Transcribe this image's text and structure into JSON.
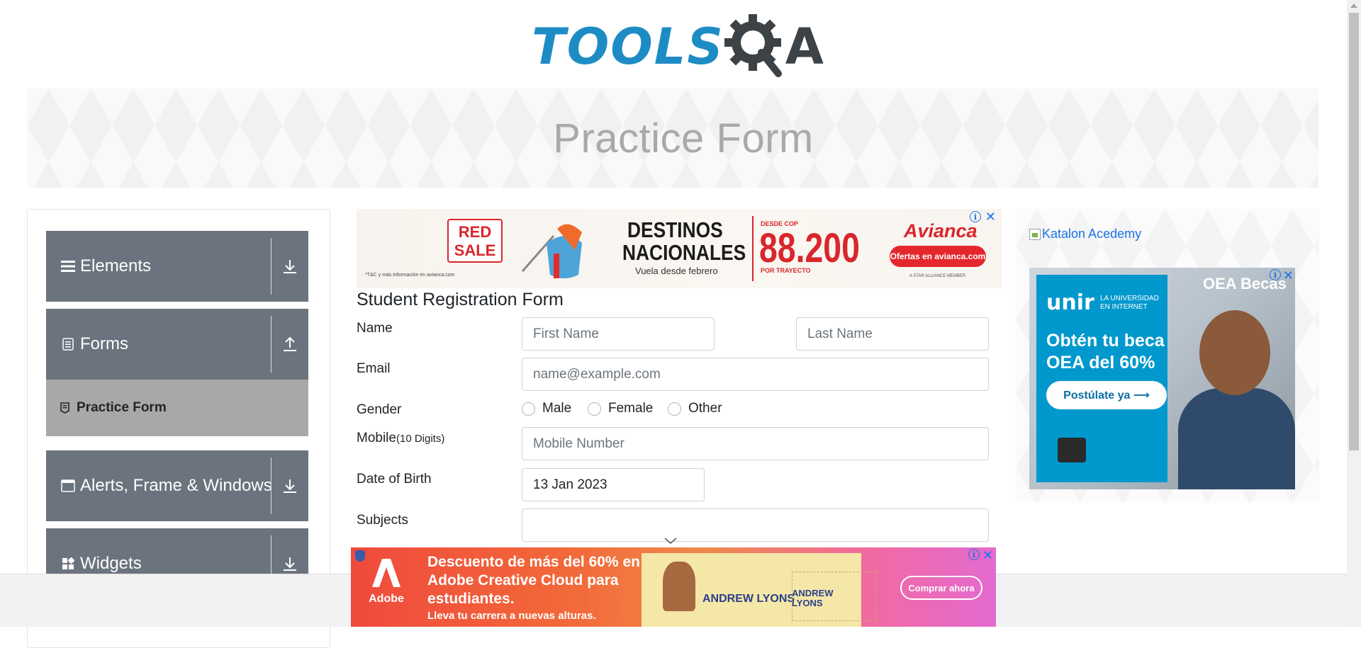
{
  "header": {
    "logo_text": "TOOLSQA",
    "logo_tools": "TOOLS",
    "logo_a": "A"
  },
  "banner": {
    "title": "Practice Form"
  },
  "sidebar": {
    "groups": [
      {
        "label": "Elements",
        "icon": "menu-icon",
        "expanded": false
      },
      {
        "label": "Forms",
        "icon": "document-icon",
        "expanded": true
      },
      {
        "label": "Alerts, Frame & Windows",
        "icon": "window-icon",
        "expanded": false
      },
      {
        "label": "Widgets",
        "icon": "widgets-icon",
        "expanded": false
      }
    ],
    "active_item": {
      "label": "Practice Form",
      "icon": "file-icon"
    }
  },
  "ad_top": {
    "badge": "RED SALE",
    "headline": "DESTINOS NACIONALES",
    "subline": "Vuela desde febrero",
    "price_prefix": "DESDE COP",
    "price": "88.200",
    "price_suffix": "POR TRAYECTO",
    "brand": "Avianca",
    "cta": "Ofertas en avianca.com",
    "fineprint": "*T&C y más información en avianca.com",
    "alliance": "A STAR ALLIANCE MEMBER"
  },
  "form": {
    "title": "Student Registration Form",
    "name_label": "Name",
    "first_name_placeholder": "First Name",
    "last_name_placeholder": "Last Name",
    "email_label": "Email",
    "email_placeholder": "name@example.com",
    "gender_label": "Gender",
    "gender_options": [
      "Male",
      "Female",
      "Other"
    ],
    "mobile_label": "Mobile",
    "mobile_hint": "(10 Digits)",
    "mobile_placeholder": "Mobile Number",
    "dob_label": "Date of Birth",
    "dob_value": "13 Jan 2023",
    "subjects_label": "Subjects"
  },
  "right_ad": {
    "katalon_alt": "Katalon Acedemy",
    "brand": "unir",
    "tagline": "LA UNIVERSIDAD EN INTERNET",
    "headline": "Obtén tu beca OEA del 60%",
    "cta": "Postúlate ya ⟶",
    "partner": "OEA Becas"
  },
  "bottom_ad": {
    "brand": "Adobe",
    "headline": "Descuento de más del 60% en Adobe Creative Cloud para estudiantes.",
    "subline": "Lleva tu carrera a nuevas alturas.",
    "name_a": "ANDREW LYONS",
    "name_b": "ANDREW LYONS",
    "cta": "Comprar ahora"
  },
  "colors": {
    "accent_blue": "#1e8cc4",
    "sidebar_group": "#6b747e",
    "sidebar_active": "#a8a8a8",
    "link_blue": "#1a73e8"
  }
}
